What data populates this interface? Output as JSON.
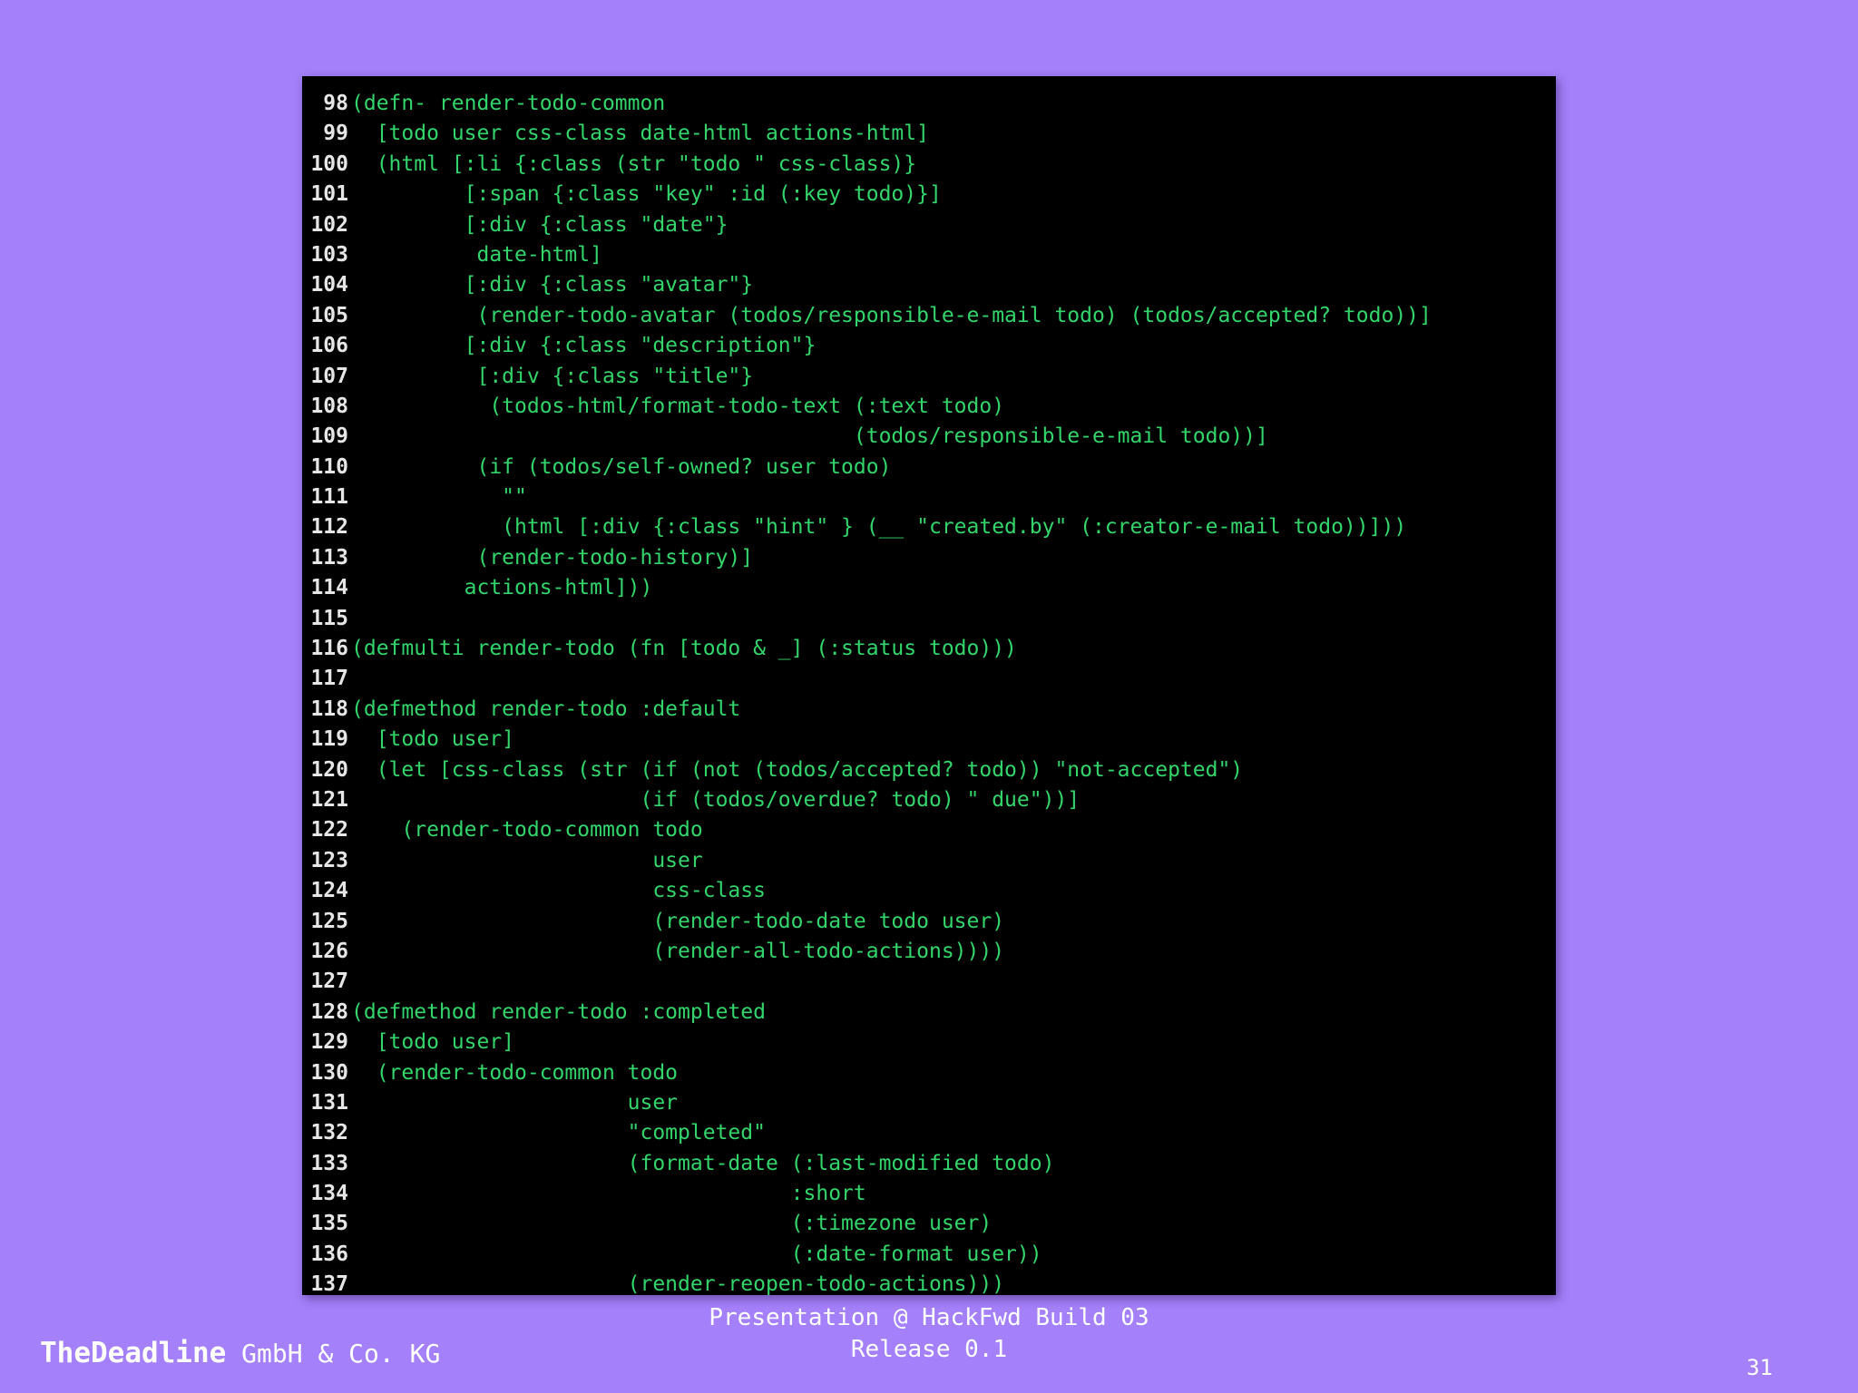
{
  "slide": {
    "brand_name": "TheDeadline",
    "brand_suffix": " GmbH & Co. KG",
    "presentation_line1": "Presentation @ HackFwd Build 03",
    "presentation_line2": "Release 0.1",
    "page_number": "31"
  },
  "colors": {
    "background": "#a480fa",
    "editor_bg": "#000000",
    "code_text": "#33d56b",
    "line_numbers": "#e6e6e6",
    "cursor": "#f0c830"
  },
  "code": {
    "lines": [
      {
        "number": "98",
        "text": "(defn- render-todo-common"
      },
      {
        "number": "99",
        "text": "  [todo user css-class date-html actions-html]"
      },
      {
        "number": "100",
        "text": "  (html [:li {:class (str \"todo \" css-class)}"
      },
      {
        "number": "101",
        "text": "         [:span {:class \"key\" :id (:key todo)}]"
      },
      {
        "number": "102",
        "text": "         [:div {:class \"date\"}"
      },
      {
        "number": "103",
        "text": "          date-html]"
      },
      {
        "number": "104",
        "text": "         [:div {:class \"avatar\"}"
      },
      {
        "number": "105",
        "text": "          (render-todo-avatar (todos/responsible-e-mail todo) (todos/accepted? todo))]"
      },
      {
        "number": "106",
        "text": "         [:div {:class \"description\"}"
      },
      {
        "number": "107",
        "text": "          [:div {:class \"title\"}"
      },
      {
        "number": "108",
        "text": "           (todos-html/format-todo-text (:text todo)"
      },
      {
        "number": "109",
        "text": "                                        (todos/responsible-e-mail todo))]"
      },
      {
        "number": "110",
        "text": "          (if (todos/self-owned? user todo)"
      },
      {
        "number": "111",
        "text": "            \"\""
      },
      {
        "number": "112",
        "text": "            (html [:div {:class \"hint\" } (__ \"created.by\" (:creator-e-mail todo))]))"
      },
      {
        "number": "113",
        "text": "          (render-todo-history)]"
      },
      {
        "number": "114",
        "text": "         actions-html]))"
      },
      {
        "number": "115",
        "text": ""
      },
      {
        "number": "116",
        "text": "(defmulti render-todo (fn [todo & _] (:status todo)))"
      },
      {
        "number": "117",
        "text": ""
      },
      {
        "number": "118",
        "text": "(defmethod render-todo :default"
      },
      {
        "number": "119",
        "text": "  [todo user]"
      },
      {
        "number": "120",
        "text": "  (let [css-class (str (if (not (todos/accepted? todo)) \"not-accepted\")"
      },
      {
        "number": "121",
        "text": "                       (if (todos/overdue? todo) \" due\"))]"
      },
      {
        "number": "122",
        "text": "    (render-todo-common todo"
      },
      {
        "number": "123",
        "text": "                        user"
      },
      {
        "number": "124",
        "text": "                        css-class"
      },
      {
        "number": "125",
        "text": "                        (render-todo-date todo user)"
      },
      {
        "number": "126",
        "text": "                        (render-all-todo-actions))))"
      },
      {
        "number": "127",
        "text": ""
      },
      {
        "number": "128",
        "text": "(defmethod render-todo :completed"
      },
      {
        "number": "129",
        "text": "  [todo user]"
      },
      {
        "number": "130",
        "text": "  (render-todo-common todo"
      },
      {
        "number": "131",
        "text": "                      user"
      },
      {
        "number": "132",
        "text": "                      \"completed\""
      },
      {
        "number": "133",
        "text": "                      (format-date (:last-modified todo)"
      },
      {
        "number": "134",
        "text": "                                   :short"
      },
      {
        "number": "135",
        "text": "                                   (:timezone user)"
      },
      {
        "number": "136",
        "text": "                                   (:date-format user))"
      },
      {
        "number": "137",
        "text": "                      (render-reopen-todo-actions)))"
      }
    ]
  }
}
